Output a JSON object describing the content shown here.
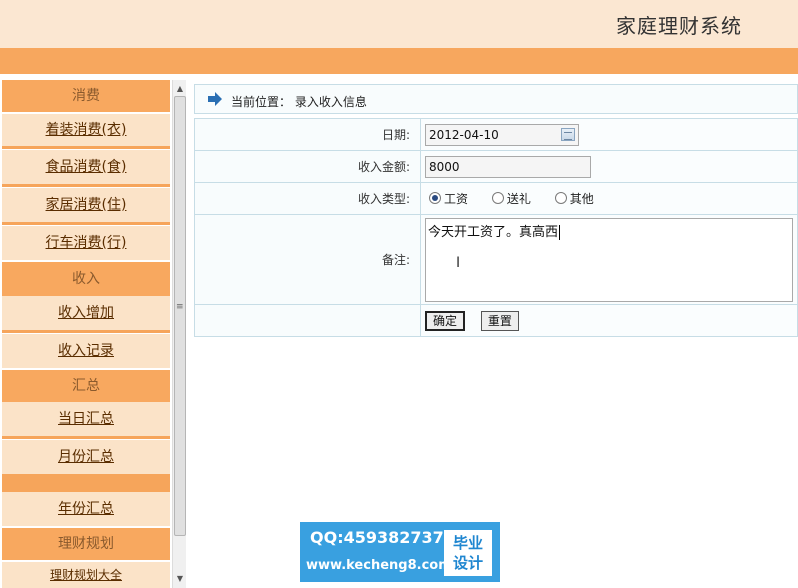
{
  "header": {
    "title": "家庭理财系统"
  },
  "sidebar": {
    "items": [
      {
        "kind": "head",
        "label": "消费"
      },
      {
        "kind": "link",
        "label": "着装消费(衣)"
      },
      {
        "kind": "link",
        "label": "食品消费(食)"
      },
      {
        "kind": "link",
        "label": "家居消费(住)"
      },
      {
        "kind": "link",
        "label": "行车消费(行)"
      },
      {
        "kind": "head",
        "label": "收入"
      },
      {
        "kind": "link",
        "label": "收入增加"
      },
      {
        "kind": "link",
        "label": "收入记录"
      },
      {
        "kind": "head",
        "label": "汇总"
      },
      {
        "kind": "link",
        "label": "当日汇总"
      },
      {
        "kind": "link",
        "label": "月份汇总"
      },
      {
        "kind": "link",
        "label": "年份汇总"
      },
      {
        "kind": "head",
        "label": "理财规划"
      },
      {
        "kind": "link",
        "label": "理财规划大全"
      }
    ]
  },
  "breadcrumb": {
    "text": "当前位置： 录入收入信息"
  },
  "form": {
    "date_label": "日期:",
    "date_value": "2012-04-10",
    "amount_label": "收入金额:",
    "amount_value": "8000",
    "type_label": "收入类型:",
    "type_options": [
      "工资",
      "送礼",
      "其他"
    ],
    "type_selected": "工资",
    "remark_label": "备注:",
    "remark_value": "今天开工资了。真高西",
    "confirm_label": "确定",
    "reset_label": "重置"
  },
  "watermark": {
    "qq": "QQ:459382737",
    "site": "www.kecheng8.com",
    "badge_line1": "毕业",
    "badge_line2": "设计"
  },
  "colors": {
    "accent": "#f8a85f",
    "header_bg": "#fbe7d2",
    "link_bg": "#fbe3c8",
    "border": "#c7dde6"
  }
}
